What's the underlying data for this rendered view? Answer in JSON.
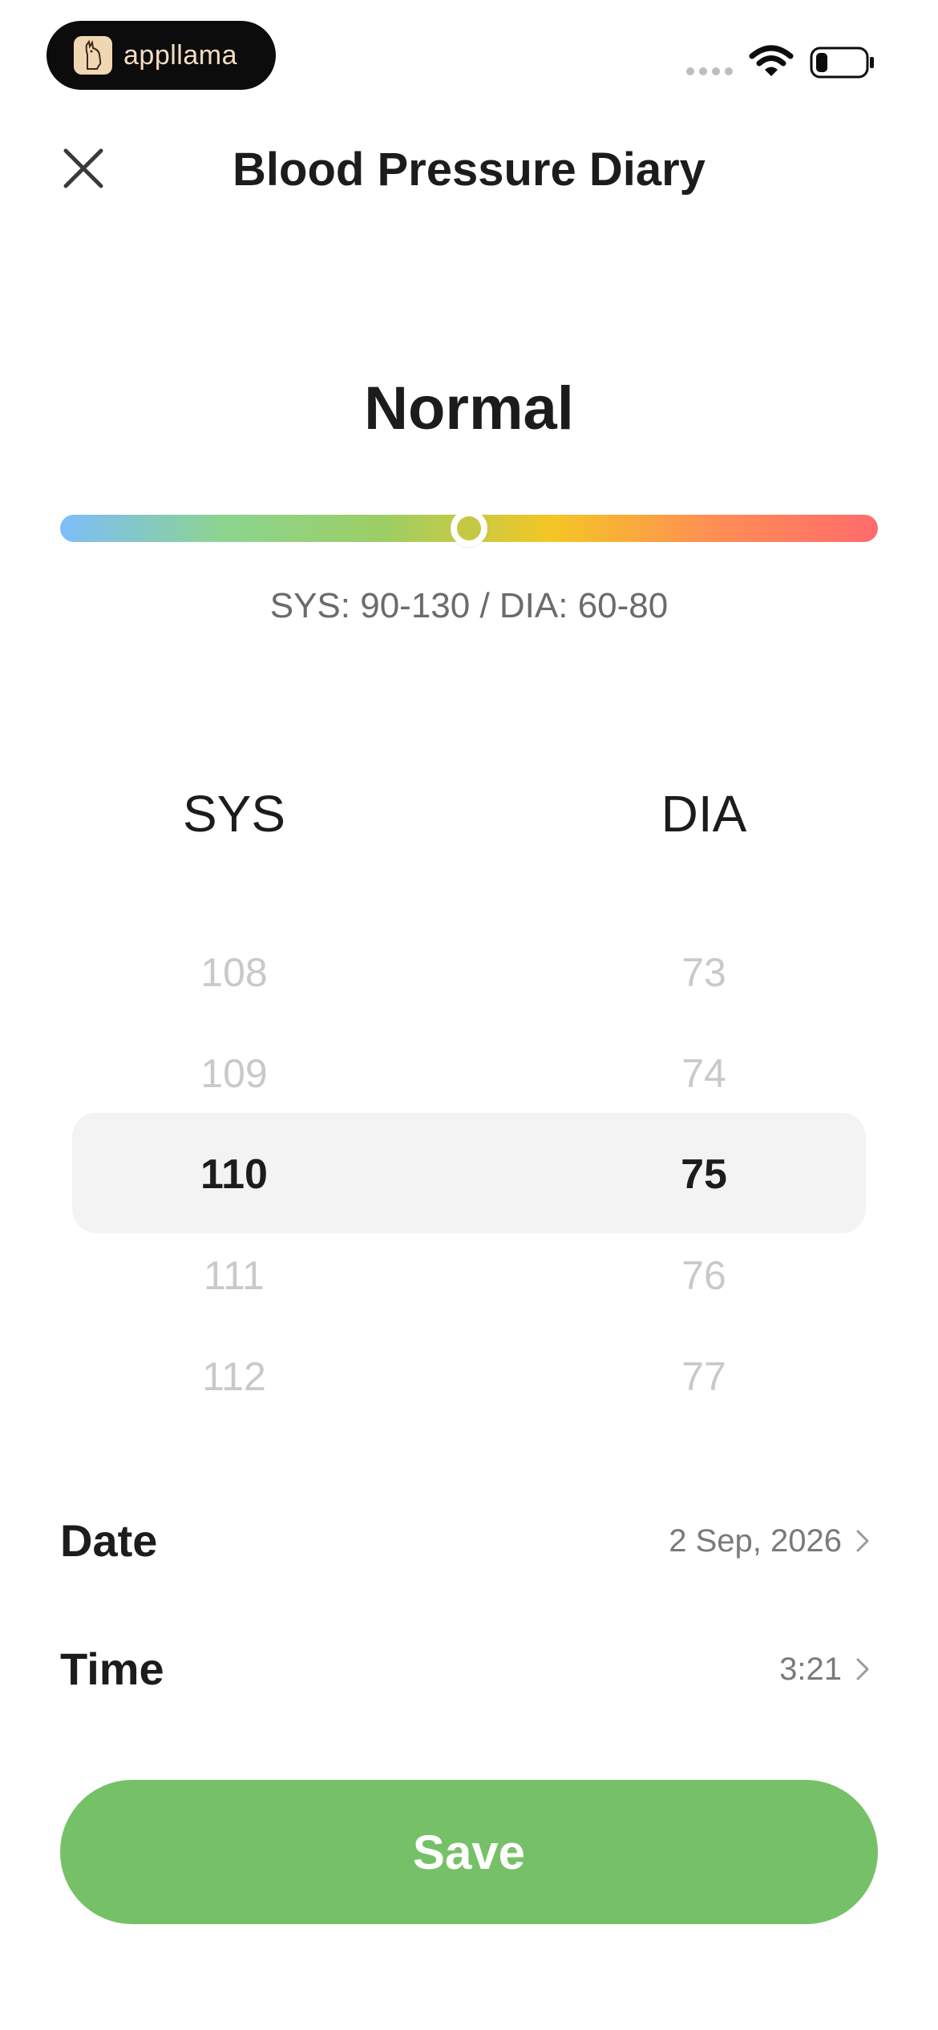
{
  "status_bar": {
    "brand_name": "appllama",
    "icons": [
      "signal-dots-icon",
      "wifi-icon",
      "battery-icon"
    ]
  },
  "header": {
    "title": "Blood Pressure Diary",
    "close_icon": "close-icon"
  },
  "status": {
    "label": "Normal",
    "range_text": "SYS: 90-130 / DIA: 60-80",
    "indicator_position": 0.5,
    "gradient_colors": [
      "#7dbdf9",
      "#8cd48f",
      "#9dce64",
      "#f4c625",
      "#ff8e55",
      "#ff6b6b"
    ],
    "indicator_color": "#c5c842"
  },
  "picker": {
    "sys_label": "SYS",
    "dia_label": "DIA",
    "sys_values": [
      "108",
      "109",
      "110",
      "111",
      "112"
    ],
    "dia_values": [
      "73",
      "74",
      "75",
      "76",
      "77"
    ],
    "selected_index": 2
  },
  "date_row": {
    "label": "Date",
    "value": "2 Sep, 2026"
  },
  "time_row": {
    "label": "Time",
    "value": "3:21"
  },
  "save_button": {
    "label": "Save",
    "color": "#76c168"
  }
}
